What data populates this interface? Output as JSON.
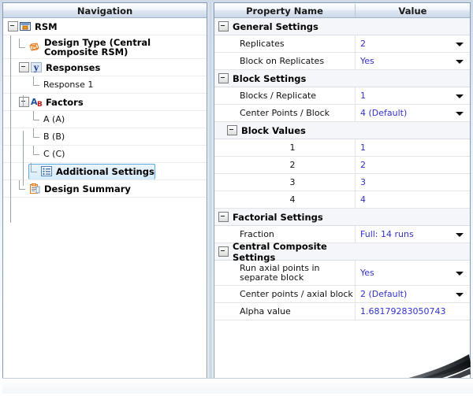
{
  "window": {
    "nav_header": "Navigation",
    "grid_header_name": "Property Name",
    "grid_header_value": "Value"
  },
  "navigation": {
    "items": [
      {
        "label": "RSM",
        "icon": "design-window-icon",
        "level": 0,
        "bold": true,
        "expander": true,
        "selected": false
      },
      {
        "label": "Design Type (Central Composite RSM)",
        "icon": "design-type-icon",
        "level": 1,
        "bold": true,
        "expander": false,
        "selected": false
      },
      {
        "label": "Responses",
        "icon": "responses-y-icon",
        "level": 1,
        "bold": true,
        "expander": true,
        "selected": false
      },
      {
        "label": "Response 1",
        "icon": "none",
        "level": 2,
        "bold": false,
        "expander": false,
        "selected": false
      },
      {
        "label": "Factors",
        "icon": "factors-ab-icon",
        "level": 1,
        "bold": true,
        "expander": true,
        "selected": false
      },
      {
        "label": "A (A)",
        "icon": "none",
        "level": 2,
        "bold": false,
        "expander": false,
        "selected": false
      },
      {
        "label": "B (B)",
        "icon": "none",
        "level": 2,
        "bold": false,
        "expander": false,
        "selected": false
      },
      {
        "label": "C (C)",
        "icon": "none",
        "level": 2,
        "bold": false,
        "expander": false,
        "selected": false
      },
      {
        "label": "Additional Settings",
        "icon": "additional-settings-list-icon",
        "level": 1,
        "bold": true,
        "expander": false,
        "selected": true
      },
      {
        "label": "Design Summary",
        "icon": "design-summary-clipboard-icon",
        "level": 1,
        "bold": true,
        "expander": false,
        "selected": false
      }
    ]
  },
  "properties": {
    "rows": [
      {
        "kind": "group",
        "indent": 0,
        "name": "General Settings",
        "value": "",
        "dropdown": false
      },
      {
        "kind": "leaf",
        "indent": 1,
        "name": "Replicates",
        "value": "2",
        "dropdown": true
      },
      {
        "kind": "leaf",
        "indent": 1,
        "name": "Block on Replicates",
        "value": "Yes",
        "dropdown": true
      },
      {
        "kind": "group",
        "indent": 0,
        "name": "Block Settings",
        "value": "",
        "dropdown": false
      },
      {
        "kind": "leaf",
        "indent": 1,
        "name": "Blocks / Replicate",
        "value": "1",
        "dropdown": true
      },
      {
        "kind": "leaf",
        "indent": 1,
        "name": "Center Points / Block",
        "value": "4 (Default)",
        "dropdown": true
      },
      {
        "kind": "group",
        "indent": 1,
        "name": "Block Values",
        "value": "",
        "dropdown": false
      },
      {
        "kind": "value",
        "indent": 2,
        "name": "1",
        "value": "1",
        "dropdown": false
      },
      {
        "kind": "value",
        "indent": 2,
        "name": "2",
        "value": "2",
        "dropdown": false
      },
      {
        "kind": "value",
        "indent": 2,
        "name": "3",
        "value": "3",
        "dropdown": false
      },
      {
        "kind": "value",
        "indent": 2,
        "name": "4",
        "value": "4",
        "dropdown": false
      },
      {
        "kind": "group",
        "indent": 0,
        "name": "Factorial Settings",
        "value": "",
        "dropdown": false
      },
      {
        "kind": "leaf",
        "indent": 1,
        "name": "Fraction",
        "value": "Full: 14 runs",
        "dropdown": true
      },
      {
        "kind": "group",
        "indent": 0,
        "name": "Central Composite Settings",
        "value": "",
        "dropdown": false
      },
      {
        "kind": "leaf2",
        "indent": 1,
        "name": "Run axial points in separate block",
        "value": "Yes",
        "dropdown": true
      },
      {
        "kind": "leaf",
        "indent": 1,
        "name": "Center points / axial block",
        "value": "2 (Default)",
        "dropdown": true
      },
      {
        "kind": "leaf",
        "indent": 1,
        "name": "Alpha value",
        "value": "1.68179283050743",
        "dropdown": false
      }
    ]
  },
  "colors": {
    "value_text": "#3232c8",
    "header_text": "#1a1a1a",
    "selection": "#5aa9dd"
  }
}
